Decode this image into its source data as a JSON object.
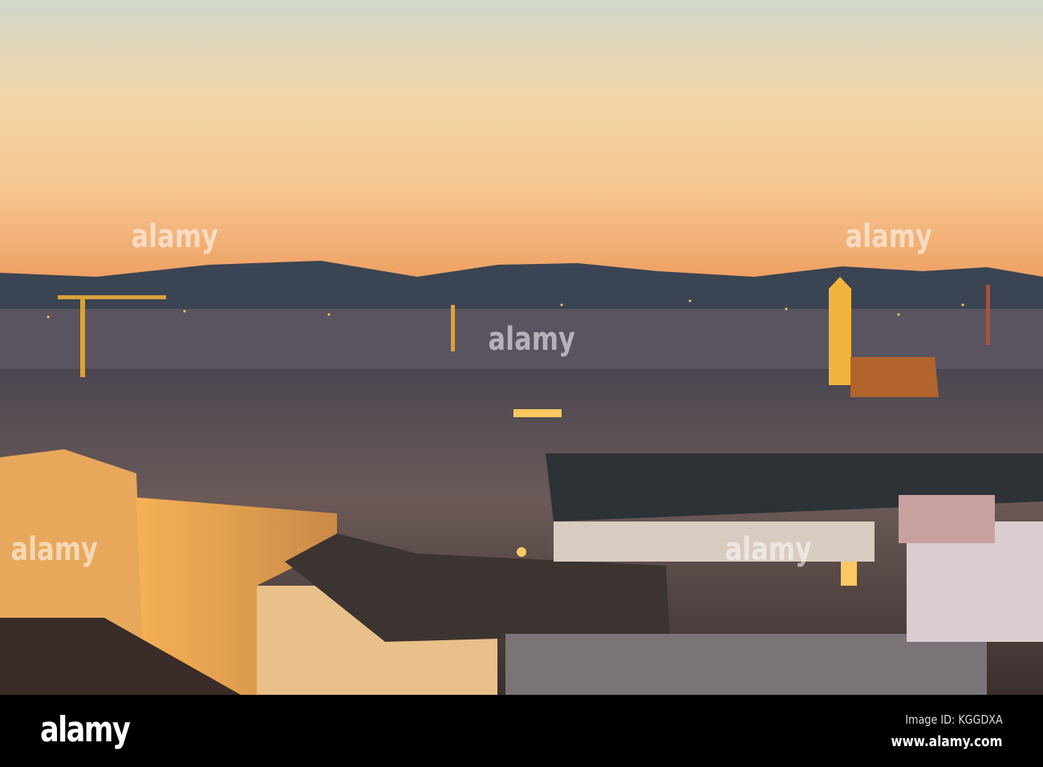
{
  "photo": {
    "subject": "city-skyline-sunset",
    "colors": {
      "sky_top": "#d2d8c9",
      "sky_mid": "#f4cf9e",
      "horizon": "#f0a566",
      "hills": "#3b4452",
      "city_dark": "#2e2a2a",
      "light": "#ffb347"
    }
  },
  "watermark": {
    "text": "alamy"
  },
  "footer": {
    "logo": "alamy",
    "image_id": "Image ID: KGGDXA",
    "website": "www.alamy.com"
  }
}
